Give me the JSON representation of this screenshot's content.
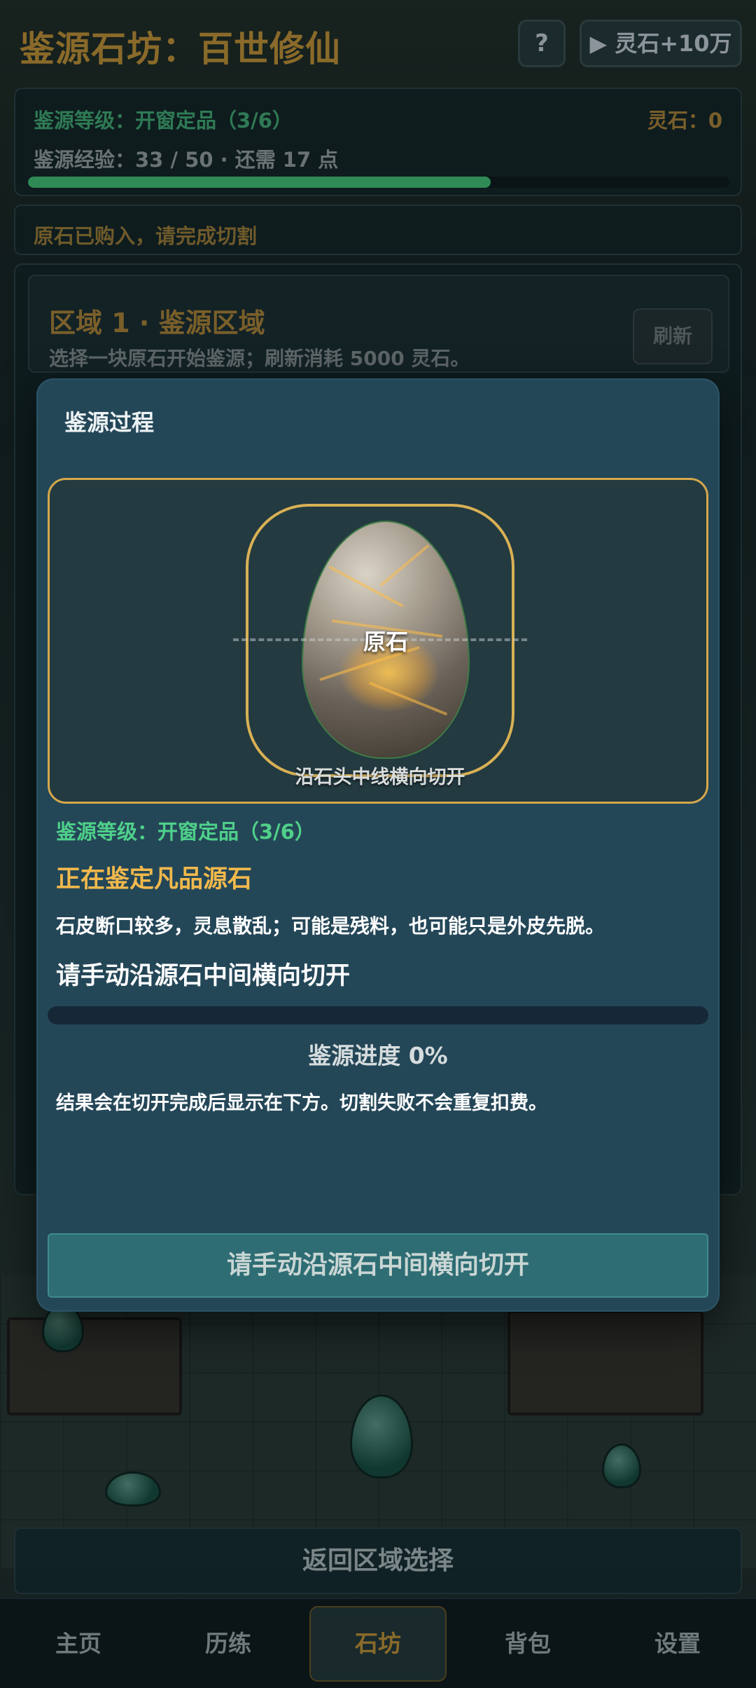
{
  "header": {
    "title": "鉴源石坊：百世修仙",
    "help_label": "?",
    "boost_label": "▶ 灵石+10万"
  },
  "status": {
    "level_label": "鉴源等级：开窗定品（3/6）",
    "stones_label": "灵石：0",
    "exp_label": "鉴源经验：33 / 50 · 还需 17 点",
    "exp_progress": 0.66
  },
  "notice": "原石已购入，请完成切割",
  "region": {
    "title": "区域 1 · 鉴源区域",
    "subtitle": "选择一块原石开始鉴源；刷新消耗 5000 灵石。",
    "refresh_label": "刷新"
  },
  "modal": {
    "title": "鉴源过程",
    "stone_label": "原石",
    "stage_hint": "沿石头中线横向切开",
    "level_label": "鉴源等级：开窗定品（3/6）",
    "identifying": "正在鉴定凡品源石",
    "description": "石皮断口较多，灵息散乱；可能是残料，也可能只是外皮先脱。",
    "instruction": "请手动沿源石中间横向切开",
    "progress_value": 0,
    "progress_label": "鉴源进度 0%",
    "note": "结果会在切开完成后显示在下方。切割失败不会重复扣费。",
    "action_label": "请手动沿源石中间横向切开"
  },
  "back_label": "返回区域选择",
  "nav": {
    "items": [
      {
        "label": "主页"
      },
      {
        "label": "历练"
      },
      {
        "label": "石坊"
      },
      {
        "label": "背包"
      },
      {
        "label": "设置"
      }
    ],
    "active_index": 2
  },
  "colors": {
    "accent_gold": "#d4a84c",
    "accent_green": "#4fd08a",
    "modal_bg": "#244758",
    "action_bg": "#2e6d74"
  }
}
